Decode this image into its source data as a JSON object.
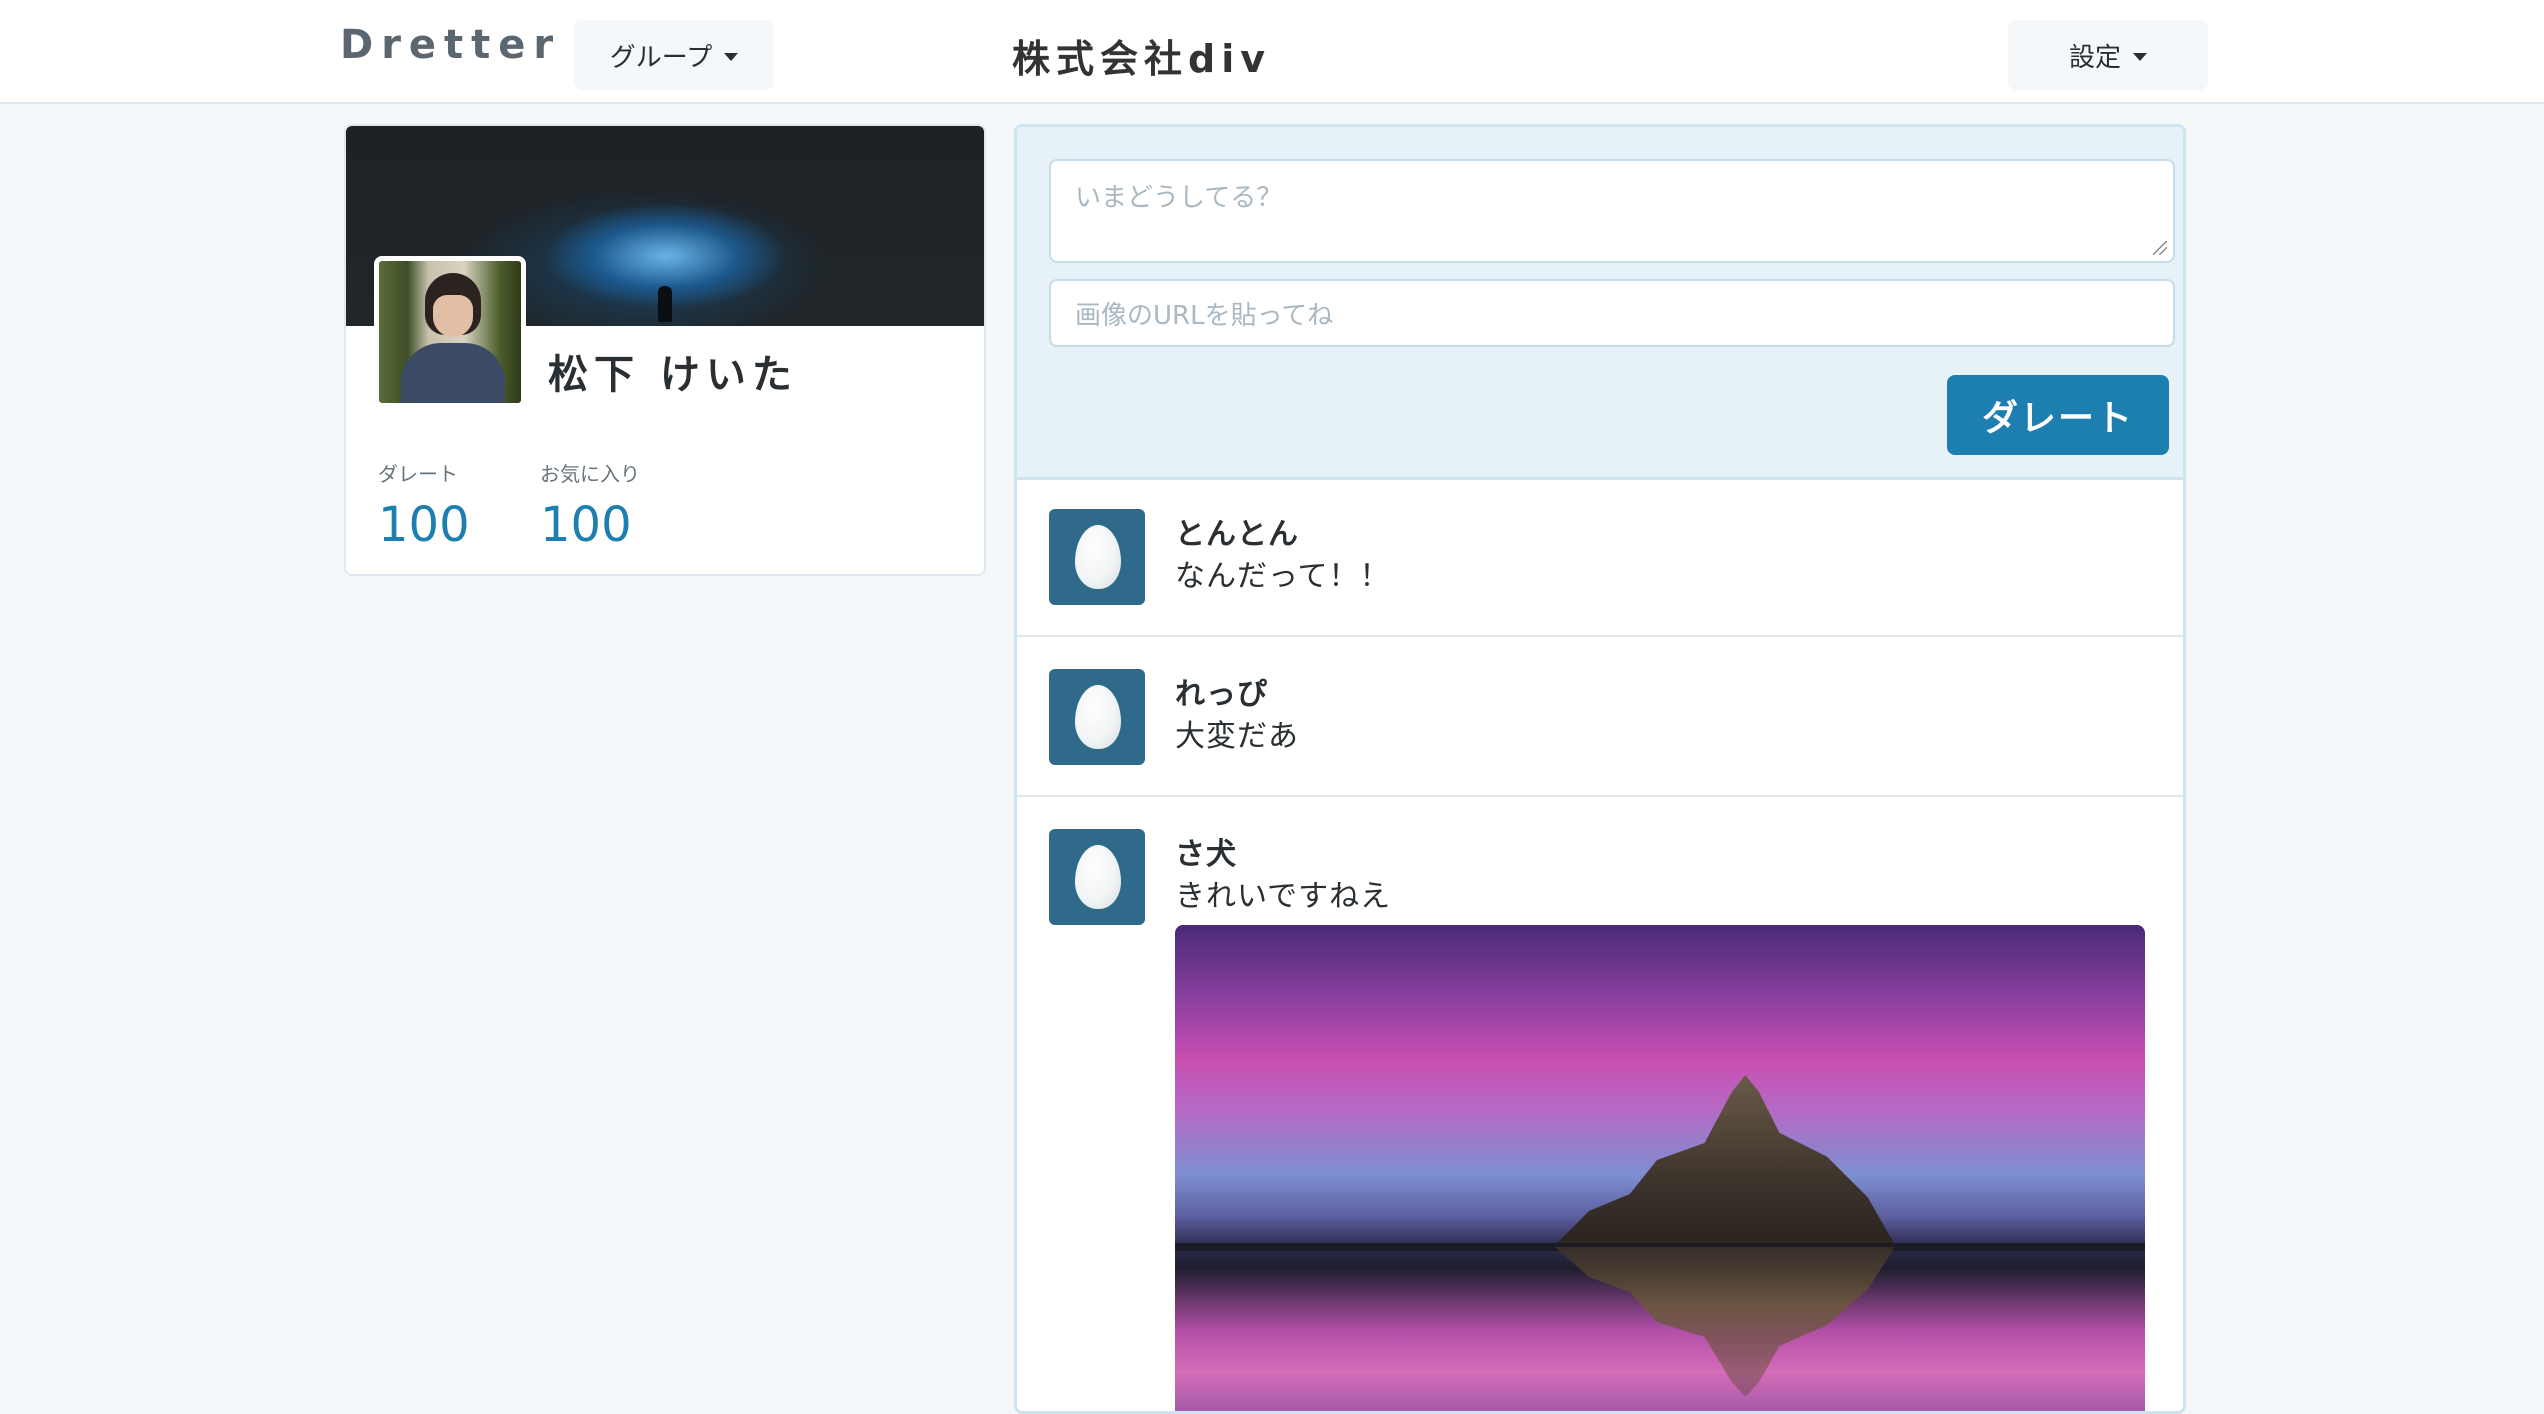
{
  "navbar": {
    "brand": "Dretter",
    "group_button": "グループ",
    "company_name": "株式会社div",
    "settings_button": "設定"
  },
  "profile": {
    "name": "松下 けいた",
    "stats": [
      {
        "label": "ダレート",
        "value": "100"
      },
      {
        "label": "お気に入り",
        "value": "100"
      }
    ]
  },
  "composer": {
    "text_placeholder": "いまどうしてる？",
    "url_placeholder": "画像のURLを貼ってね",
    "submit_label": "ダレート"
  },
  "timeline": [
    {
      "user": "とんとん",
      "text": "なんだって！！"
    },
    {
      "user": "れっぴ",
      "text": "大変だあ"
    },
    {
      "user": "さ犬",
      "text": "きれいですねえ"
    }
  ],
  "colors": {
    "accent": "#1d7fb0",
    "background": "#f5f8fa",
    "avatar_bg": "#2f6a8a"
  }
}
